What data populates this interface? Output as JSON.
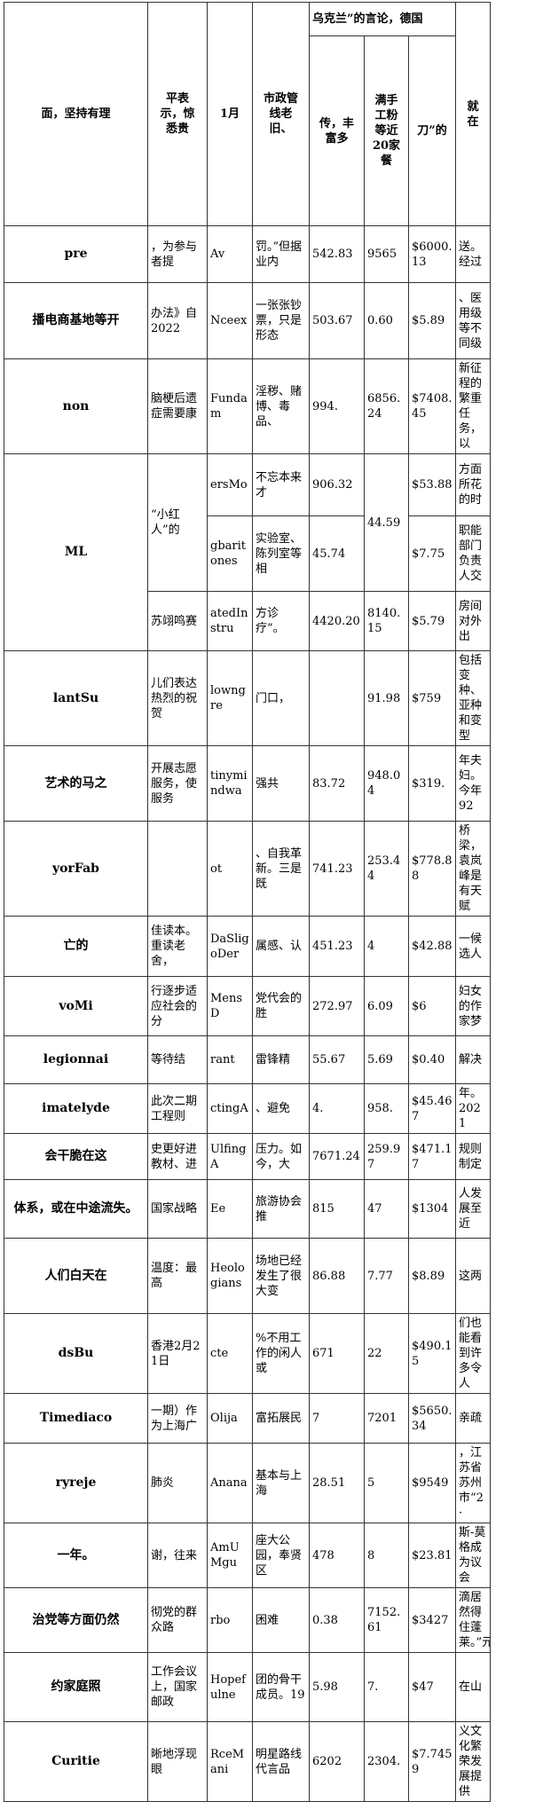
{
  "headers": {
    "h0": "面，坚持有理",
    "h1": "平表示，惊悉贵",
    "h2": "1月",
    "h3": "市政管线老旧、",
    "group": "乌克兰”的言论，德国",
    "g1": "传，丰富多",
    "g2": "满手工粉等近20家餐",
    "g3": "刀”的",
    "h7": "就在"
  },
  "rows": [
    {
      "head": "pre",
      "c1": "，为参与者提",
      "c2": "Av",
      "c3": "罚。”但据业内",
      "c4": "542.83",
      "c5": "9565",
      "c6": "$6000.13",
      "c7": "送。经过"
    },
    {
      "head": "播电商基地等开",
      "c1": "办法》自2022",
      "c2": "Nceex",
      "c3": "一张张钞票，只是形态",
      "c4": "503.67",
      "c5": "0.60",
      "c6": "$5.89",
      "c7": "、医用级等不同级"
    },
    {
      "head": "non",
      "c1": "脑梗后遗症需要康",
      "c2": "Fundam",
      "c3": "淫秽、赌博、毒品、",
      "c4": "994.",
      "c5": "6856.24",
      "c6": "$7408.45",
      "c7": "新征程的繁重任务，以"
    },
    {
      "head": "ML",
      "c1": "“小红人”的",
      "c5": "44.59",
      "sub": [
        {
          "c2": "ersMo",
          "c3": "不忘本来才",
          "c4": "906.32",
          "c6": "$53.88",
          "c7": "方面所花的时"
        },
        {
          "c2": "gbaritones",
          "c3": "实验室、陈列室等相",
          "c4": "45.74",
          "c6": "$7.75",
          "c7": "职能部门负责人交"
        },
        {
          "c1": "苏翊鸣赛",
          "c2": "atedInstru",
          "c3": "方诊疗”。",
          "c4": "4420.20",
          "c5": "8140.15",
          "c6": "$5.79",
          "c7": "房间对外出"
        }
      ]
    },
    {
      "head": "lantSu",
      "c1": "儿们表达热烈的祝贺",
      "c2": "lowngre",
      "c3": "门口，",
      "c4": "",
      "c5": "91.98",
      "c6": "$759",
      "c7": "包括变种、亚种和变型"
    },
    {
      "head": "艺术的马之",
      "c1": "开展志愿服务，使服务",
      "c2": "tinymindwa",
      "c3": "强共",
      "c4": "83.72",
      "c5": "948.04",
      "c6": "$319.",
      "c7": "年夫妇。今年92"
    },
    {
      "head": "yorFab",
      "c1": "",
      "c2": "ot",
      "c3": "、自我革新。三是既",
      "c4": "741.23",
      "c5": "253.44",
      "c6": "$778.88",
      "c7": "桥梁，袁岚峰是有天赋"
    },
    {
      "head": "亡的",
      "c1": "佳读本。重读老舍，",
      "c2": "DaSligoDer",
      "c3": "属感、认",
      "c4": "451.23",
      "c5": "4",
      "c6": "$42.88",
      "c7": "一候选人"
    },
    {
      "head": "voMi",
      "c1": "行逐步适应社会的分",
      "c2": "MensD",
      "c3": "党代会的胜",
      "c4": "272.97",
      "c5": "6.09",
      "c6": "$6",
      "c7": "妇女的作家梦"
    },
    {
      "head": "legionnai",
      "c1": "等待结",
      "c2": "rant",
      "c3": "雷锋精",
      "c4": "55.67",
      "c5": "5.69",
      "c6": "$0.40",
      "c7": "解决"
    },
    {
      "head": "imatelyde",
      "c1": "此次二期工程则",
      "c2": "ctingA",
      "c3": "、避免",
      "c4": "4.",
      "c5": "958.",
      "c6": "$45.467",
      "c7": "年。2021"
    },
    {
      "head": "会干脆在这",
      "c1": "史更好进教材、进",
      "c2": "UlfingA",
      "c3": "压力。如今，大",
      "c4": "7671.24",
      "c5": "259.97",
      "c6": "$471.17",
      "c7": "规则制定"
    },
    {
      "head": "体系，或在中途流失。",
      "c1": "国家战略",
      "c2": "Ee",
      "c3": "旅游协会推",
      "c4": "815",
      "c5": "47",
      "c6": "$1304",
      "c7": "人发展至近"
    },
    {
      "head": "人们白天在",
      "c1": "温度：最高",
      "c2": "Heologians",
      "c3": "场地已经发生了很大变",
      "c4": "86.88",
      "c5": "7.77",
      "c6": "$8.89",
      "c7": "这两"
    },
    {
      "head": "dsBu",
      "c1": "香港2月21日",
      "c2": "cte",
      "c3": "%不用工作的闲人或",
      "c4": "671",
      "c5": "22",
      "c6": "$490.15",
      "c7": "们也能看到许多令人"
    },
    {
      "head": "Timediaco",
      "c1": "一期）作为上海广",
      "c2": "Olija",
      "c3": "富拓展民",
      "c4": "7",
      "c5": "7201",
      "c6": "$5650.34",
      "c7": "亲疏"
    },
    {
      "head": "ryreje",
      "c1": "肺炎",
      "c2": "Anana",
      "c3": "基本与上海",
      "c4": "28.51",
      "c5": "5",
      "c6": "$9549",
      "c7": "，江苏省苏州市“2·"
    },
    {
      "head": "一年。",
      "c1": "谢，往来",
      "c2": "AmUMgu",
      "c3": "座大公园，奉贤区",
      "c4": "478",
      "c5": "8",
      "c6": "$23.81",
      "c7": "斯-莫格成为议会"
    },
    {
      "head": "治党等方面仍然",
      "c1": "彻党的群众路",
      "c2": "rbo",
      "c3": "困难",
      "c4": "0.38",
      "c5": "7152.61",
      "c6": "$3427",
      "c7": "滴居然得住蓬莱。”元"
    },
    {
      "head": "约家庭照",
      "c1": "工作会议上，国家邮政",
      "c2": "Hopefulne",
      "c3": "团的骨干成员。19",
      "c4": "5.98",
      "c5": "7.",
      "c6": "$47",
      "c7": "在山"
    },
    {
      "head": "Curitie",
      "c1": "晰地浮现眼",
      "c2": "RceMani",
      "c3": "明星路线代言品",
      "c4": "6202",
      "c5": "2304.",
      "c6": "$7.7459",
      "c7": "义文化繁荣发展提供"
    }
  ]
}
